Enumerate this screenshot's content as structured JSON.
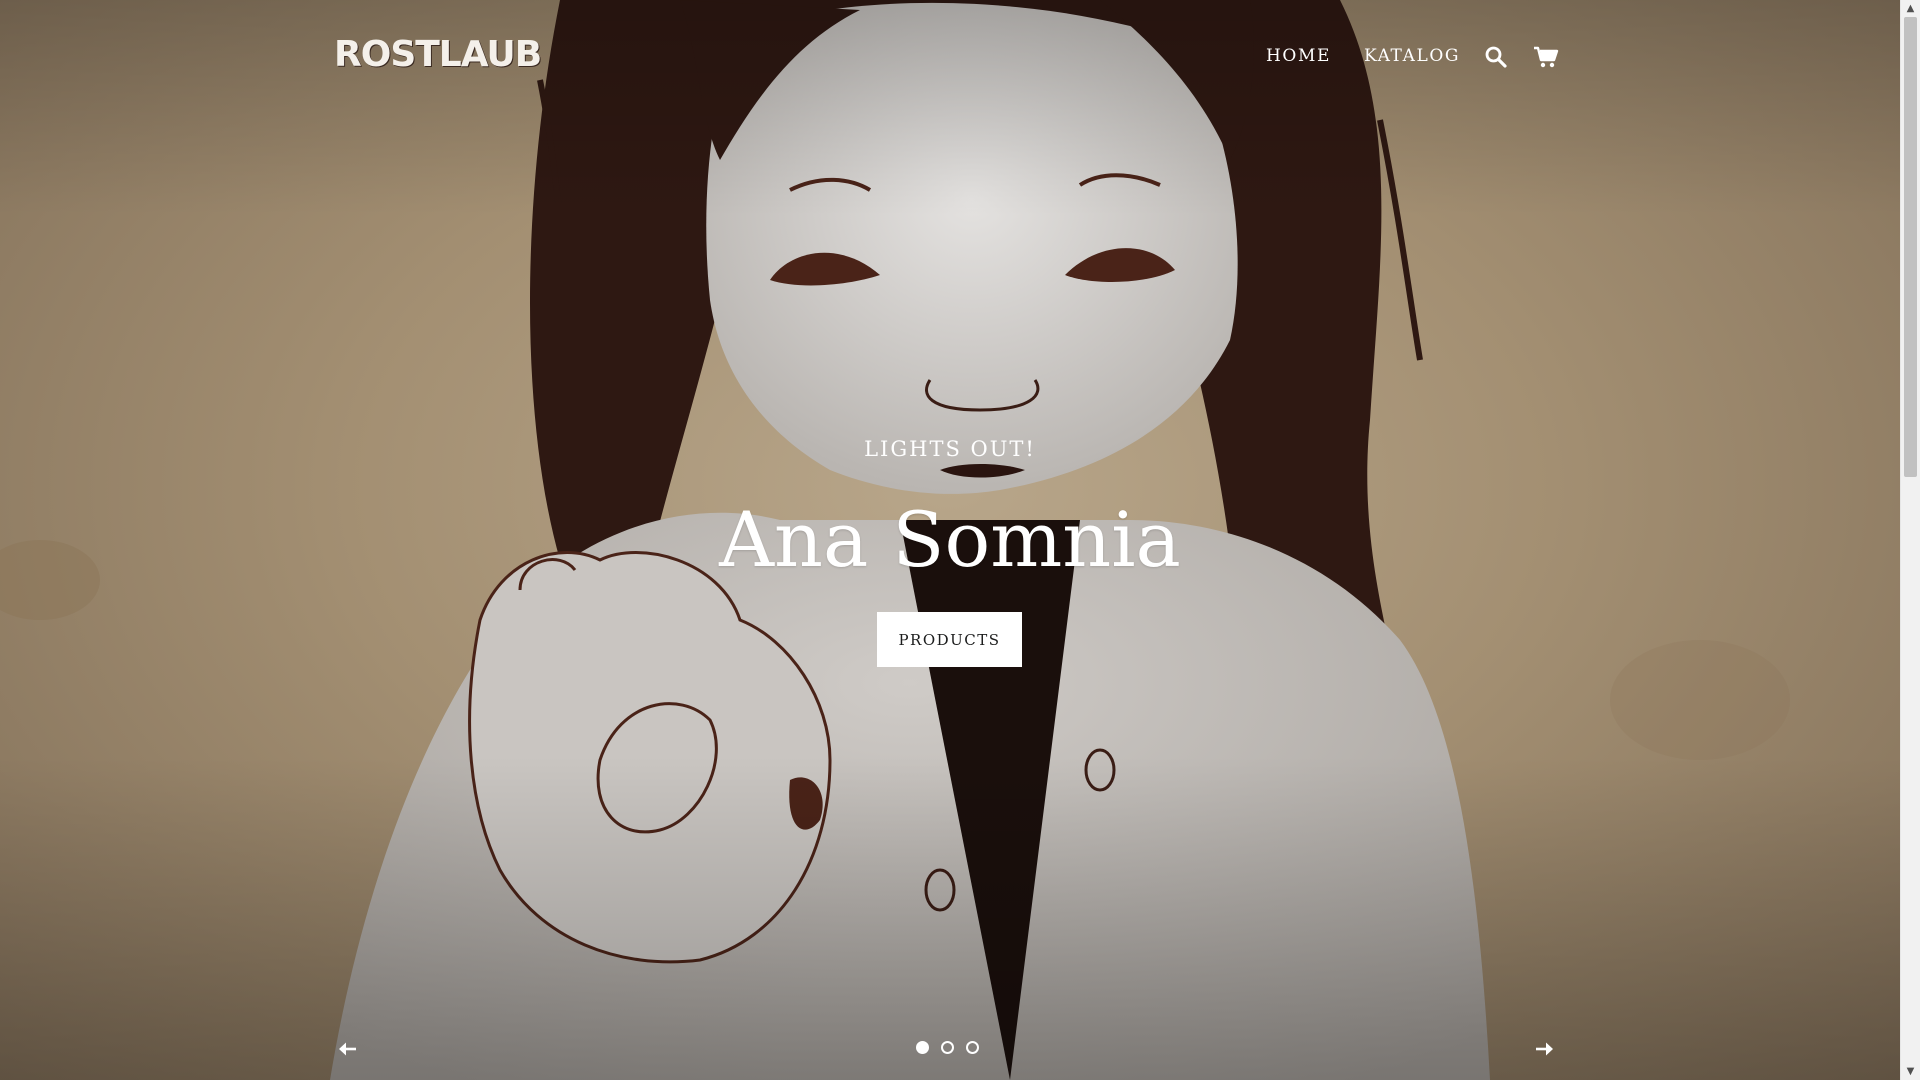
{
  "header": {
    "logo_text": "ROSTLAUB",
    "nav": [
      {
        "label": "HOME"
      },
      {
        "label": "KATALOG"
      }
    ],
    "icons": {
      "search": "search-icon",
      "cart": "cart-icon"
    }
  },
  "hero": {
    "subtitle": "LIGHTS OUT!",
    "title": "Ana Somnia",
    "button_label": "PRODUCTS",
    "slides": [
      {
        "active": true
      },
      {
        "active": false
      },
      {
        "active": false
      }
    ],
    "controls": {
      "prev": "arrow-left-icon",
      "next": "arrow-right-icon"
    }
  },
  "colors": {
    "background_tone": "#a38f72",
    "art_dark": "#2e1812",
    "art_line": "#4a2318",
    "art_light": "#d8d6d4",
    "text": "#ffffff"
  }
}
